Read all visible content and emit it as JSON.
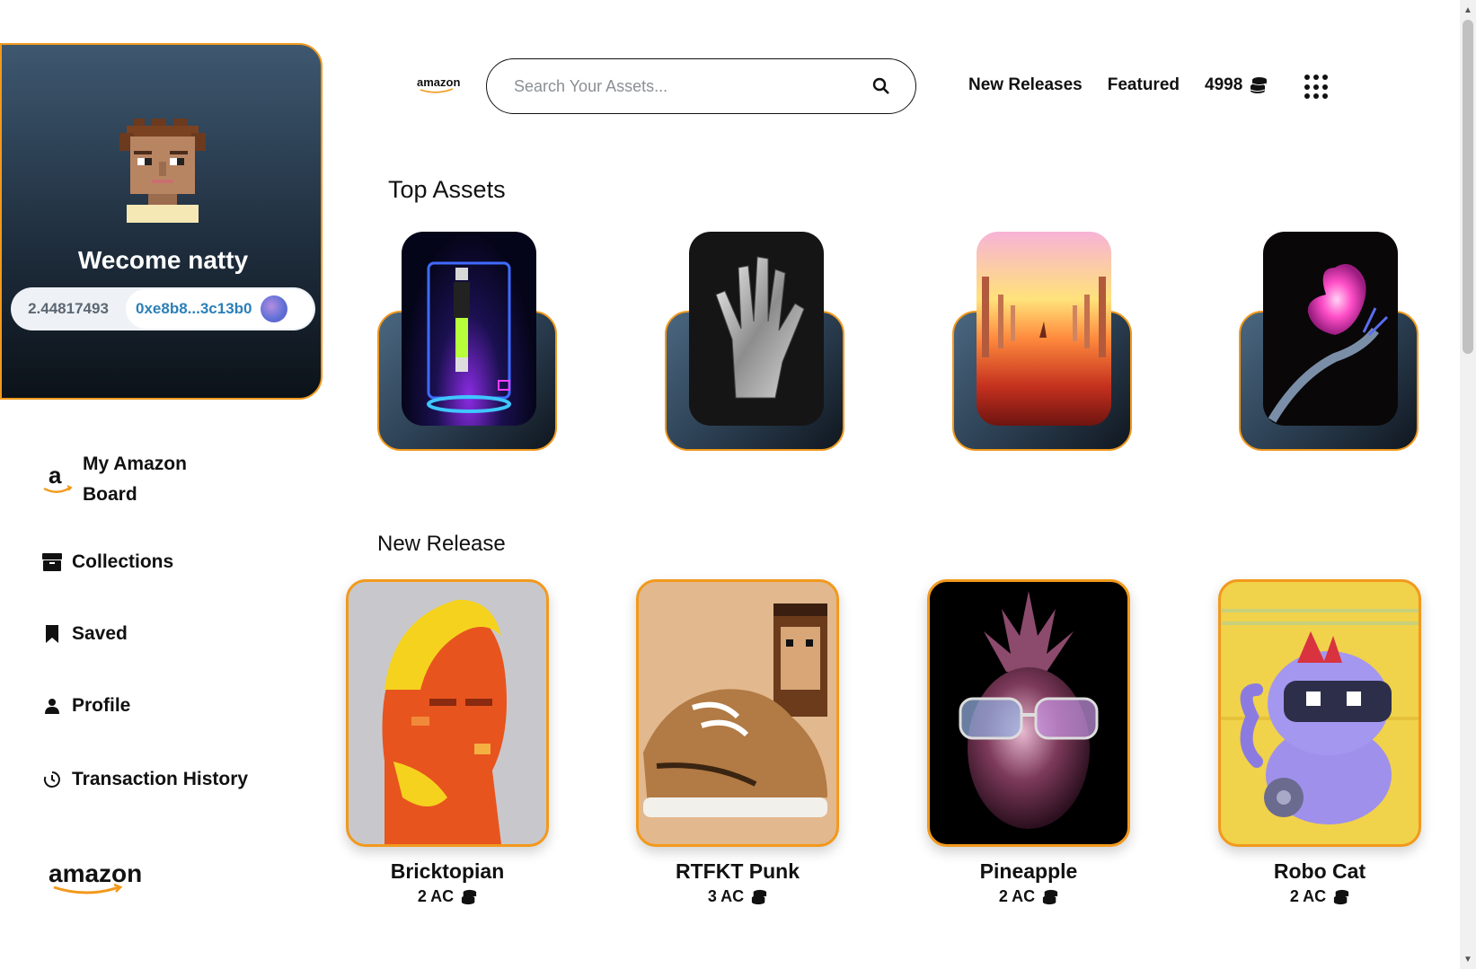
{
  "profile": {
    "welcome": "Wecome natty",
    "balance": "2.44817493",
    "address": "0xe8b8...3c13b0"
  },
  "nav": {
    "board": "My Amazon Board",
    "collections": "Collections",
    "saved": "Saved",
    "profile": "Profile",
    "history": "Transaction History"
  },
  "brand": {
    "logo_small": "amazon",
    "logo_footer": "amazon",
    "accent": "#f2991c"
  },
  "search": {
    "placeholder": "Search Your Assets..."
  },
  "header": {
    "new_releases": "New Releases",
    "featured": "Featured",
    "coins": "4998"
  },
  "top_assets": {
    "title": "Top Assets",
    "items": [
      "neon-hologram-figure",
      "crystal-glove",
      "sunset-sea-pillars",
      "pink-crystal-heart-hand"
    ]
  },
  "new_release": {
    "title": "New Release",
    "items": [
      {
        "name": "Bricktopian",
        "price": "2 AC"
      },
      {
        "name": "RTFKT Punk",
        "price": "3 AC"
      },
      {
        "name": "Pineapple",
        "price": "2 AC"
      },
      {
        "name": "Robo Cat",
        "price": "2 AC"
      }
    ]
  }
}
